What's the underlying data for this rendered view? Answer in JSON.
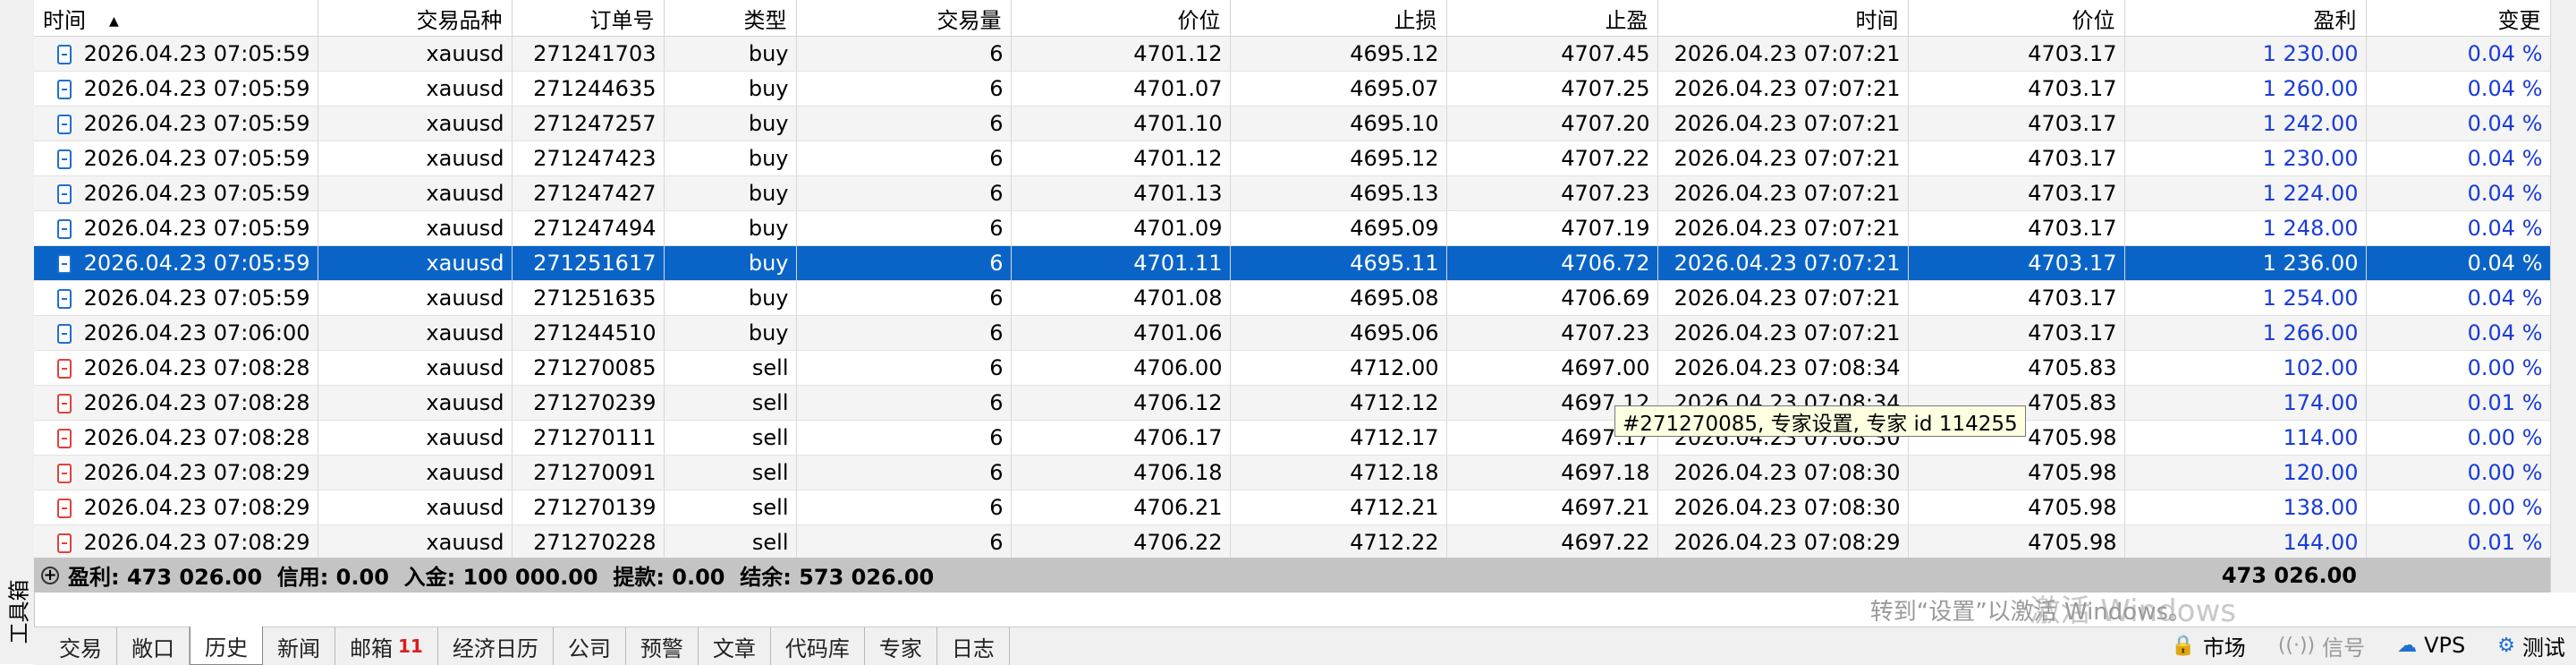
{
  "toolbox": {
    "label": "工具箱"
  },
  "columns": [
    "时间",
    "交易品种",
    "订单号",
    "类型",
    "交易量",
    "价位",
    "止损",
    "止盈",
    "时间",
    "价位",
    "盈利",
    "变更"
  ],
  "rows": [
    {
      "open_time": "2026.04.23 07:05:59",
      "symbol": "xauusd",
      "order": "271241703",
      "type": "buy",
      "volume": "6",
      "open_price": "4701.12",
      "sl": "4695.12",
      "tp": "4707.45",
      "close_time": "2026.04.23 07:07:21",
      "close_price": "4703.17",
      "profit": "1 230.00",
      "change": "0.04 %"
    },
    {
      "open_time": "2026.04.23 07:05:59",
      "symbol": "xauusd",
      "order": "271244635",
      "type": "buy",
      "volume": "6",
      "open_price": "4701.07",
      "sl": "4695.07",
      "tp": "4707.25",
      "close_time": "2026.04.23 07:07:21",
      "close_price": "4703.17",
      "profit": "1 260.00",
      "change": "0.04 %"
    },
    {
      "open_time": "2026.04.23 07:05:59",
      "symbol": "xauusd",
      "order": "271247257",
      "type": "buy",
      "volume": "6",
      "open_price": "4701.10",
      "sl": "4695.10",
      "tp": "4707.20",
      "close_time": "2026.04.23 07:07:21",
      "close_price": "4703.17",
      "profit": "1 242.00",
      "change": "0.04 %"
    },
    {
      "open_time": "2026.04.23 07:05:59",
      "symbol": "xauusd",
      "order": "271247423",
      "type": "buy",
      "volume": "6",
      "open_price": "4701.12",
      "sl": "4695.12",
      "tp": "4707.22",
      "close_time": "2026.04.23 07:07:21",
      "close_price": "4703.17",
      "profit": "1 230.00",
      "change": "0.04 %"
    },
    {
      "open_time": "2026.04.23 07:05:59",
      "symbol": "xauusd",
      "order": "271247427",
      "type": "buy",
      "volume": "6",
      "open_price": "4701.13",
      "sl": "4695.13",
      "tp": "4707.23",
      "close_time": "2026.04.23 07:07:21",
      "close_price": "4703.17",
      "profit": "1 224.00",
      "change": "0.04 %"
    },
    {
      "open_time": "2026.04.23 07:05:59",
      "symbol": "xauusd",
      "order": "271247494",
      "type": "buy",
      "volume": "6",
      "open_price": "4701.09",
      "sl": "4695.09",
      "tp": "4707.19",
      "close_time": "2026.04.23 07:07:21",
      "close_price": "4703.17",
      "profit": "1 248.00",
      "change": "0.04 %"
    },
    {
      "open_time": "2026.04.23 07:05:59",
      "symbol": "xauusd",
      "order": "271251617",
      "type": "buy",
      "volume": "6",
      "open_price": "4701.11",
      "sl": "4695.11",
      "tp": "4706.72",
      "close_time": "2026.04.23 07:07:21",
      "close_price": "4703.17",
      "profit": "1 236.00",
      "change": "0.04 %",
      "selected": true
    },
    {
      "open_time": "2026.04.23 07:05:59",
      "symbol": "xauusd",
      "order": "271251635",
      "type": "buy",
      "volume": "6",
      "open_price": "4701.08",
      "sl": "4695.08",
      "tp": "4706.69",
      "close_time": "2026.04.23 07:07:21",
      "close_price": "4703.17",
      "profit": "1 254.00",
      "change": "0.04 %"
    },
    {
      "open_time": "2026.04.23 07:06:00",
      "symbol": "xauusd",
      "order": "271244510",
      "type": "buy",
      "volume": "6",
      "open_price": "4701.06",
      "sl": "4695.06",
      "tp": "4707.23",
      "close_time": "2026.04.23 07:07:21",
      "close_price": "4703.17",
      "profit": "1 266.00",
      "change": "0.04 %"
    },
    {
      "open_time": "2026.04.23 07:08:28",
      "symbol": "xauusd",
      "order": "271270085",
      "type": "sell",
      "volume": "6",
      "open_price": "4706.00",
      "sl": "4712.00",
      "tp": "4697.00",
      "close_time": "2026.04.23 07:08:34",
      "close_price": "4705.83",
      "profit": "102.00",
      "change": "0.00 %"
    },
    {
      "open_time": "2026.04.23 07:08:28",
      "symbol": "xauusd",
      "order": "271270239",
      "type": "sell",
      "volume": "6",
      "open_price": "4706.12",
      "sl": "4712.12",
      "tp": "4697.12",
      "close_time": "2026.04.23 07:08:34",
      "close_price": "4705.83",
      "profit": "174.00",
      "change": "0.01 %"
    },
    {
      "open_time": "2026.04.23 07:08:28",
      "symbol": "xauusd",
      "order": "271270111",
      "type": "sell",
      "volume": "6",
      "open_price": "4706.17",
      "sl": "4712.17",
      "tp": "4697.17",
      "close_time": "2026.04.23 07:08:30",
      "close_price": "4705.98",
      "profit": "114.00",
      "change": "0.00 %"
    },
    {
      "open_time": "2026.04.23 07:08:29",
      "symbol": "xauusd",
      "order": "271270091",
      "type": "sell",
      "volume": "6",
      "open_price": "4706.18",
      "sl": "4712.18",
      "tp": "4697.18",
      "close_time": "2026.04.23 07:08:30",
      "close_price": "4705.98",
      "profit": "120.00",
      "change": "0.00 %"
    },
    {
      "open_time": "2026.04.23 07:08:29",
      "symbol": "xauusd",
      "order": "271270139",
      "type": "sell",
      "volume": "6",
      "open_price": "4706.21",
      "sl": "4712.21",
      "tp": "4697.21",
      "close_time": "2026.04.23 07:08:30",
      "close_price": "4705.98",
      "profit": "138.00",
      "change": "0.00 %"
    },
    {
      "open_time": "2026.04.23 07:08:29",
      "symbol": "xauusd",
      "order": "271270228",
      "type": "sell",
      "volume": "6",
      "open_price": "4706.22",
      "sl": "4712.22",
      "tp": "4697.22",
      "close_time": "2026.04.23 07:08:29",
      "close_price": "4705.98",
      "profit": "144.00",
      "change": "0.01 %"
    }
  ],
  "summary": {
    "text": "盈利: 473 026.00  信用: 0.00  入金: 100 000.00  提款: 0.00  结余: 573 026.00",
    "profit_total": "473 026.00"
  },
  "tooltip": "#271270085, 专家设置, 专家 id 114255",
  "tabs": [
    {
      "label": "交易"
    },
    {
      "label": "敞口"
    },
    {
      "label": "历史",
      "active": true
    },
    {
      "label": "新闻"
    },
    {
      "label": "邮箱",
      "badge": "11"
    },
    {
      "label": "经济日历"
    },
    {
      "label": "公司"
    },
    {
      "label": "预警"
    },
    {
      "label": "文章"
    },
    {
      "label": "代码库"
    },
    {
      "label": "专家"
    },
    {
      "label": "日志"
    }
  ],
  "status": {
    "market": "市场",
    "signals": "信号",
    "vps": "VPS",
    "tester": "测试"
  },
  "windows_activation": {
    "line1": "激活 Windows",
    "line2": "转到“设置”以激活 Windows。"
  },
  "colors": {
    "selected_row": "#0a64c8",
    "profit_text": "#1a3cd8",
    "buy_icon": "#1e6fd0",
    "sell_icon": "#e0413a",
    "summary_bg": "#c4c4c4",
    "mail_badge": "#d81e1e"
  },
  "icons": {
    "buy_row": "buy-order-icon",
    "sell_row": "sell-order-icon",
    "summary_expand": "plus-circle-icon",
    "sort": "sort-ascending-icon",
    "market": "lock-icon",
    "signals": "signal-icon",
    "vps": "cloud-icon",
    "tester": "gear-icon"
  }
}
